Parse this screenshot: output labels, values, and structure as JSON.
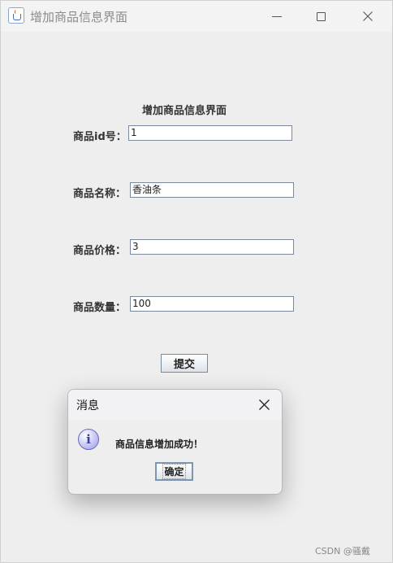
{
  "window": {
    "title": "增加商品信息界面",
    "icon": "java-cup-icon",
    "controls": [
      "minimize-icon",
      "maximize-icon",
      "close-icon"
    ]
  },
  "form": {
    "heading": "增加商品信息界面",
    "fields": [
      {
        "label": "商品id号：",
        "value": "1"
      },
      {
        "label": "商品名称：",
        "value": "香油条"
      },
      {
        "label": "商品价格：",
        "value": "3"
      },
      {
        "label": "商品数量：",
        "value": "100"
      }
    ],
    "submit_label": "提交"
  },
  "dialog": {
    "title": "消息",
    "icon": "info-icon",
    "icon_glyph": "i",
    "message": "商品信息增加成功！",
    "ok_label": "确定"
  },
  "watermark": "CSDN @骚戴"
}
